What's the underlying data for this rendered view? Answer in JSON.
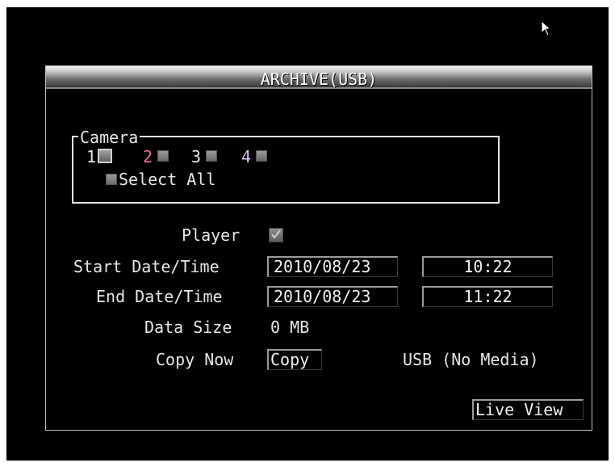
{
  "dialog": {
    "title": "ARCHIVE(USB)"
  },
  "camera_group": {
    "legend": "Camera",
    "cameras": [
      {
        "label": "1",
        "checked": false,
        "focused": true
      },
      {
        "label": "2",
        "checked": false,
        "focused": false
      },
      {
        "label": "3",
        "checked": false,
        "focused": false
      },
      {
        "label": "4",
        "checked": false,
        "focused": false
      }
    ],
    "select_all_label": "Select All"
  },
  "player": {
    "label": "Player",
    "checked": true
  },
  "start": {
    "label": "Start Date/Time",
    "date": "2010/08/23",
    "time": "10:22"
  },
  "end": {
    "label": "End Date/Time",
    "date": "2010/08/23",
    "time": "11:22"
  },
  "data_size": {
    "label": "Data Size",
    "value": "0 MB"
  },
  "copy_now": {
    "label": "Copy Now",
    "button": "Copy",
    "status": "USB (No Media)"
  },
  "live_view_button": "Live View",
  "icons": {
    "cursor": "mouse-pointer-icon",
    "check": "checkmark-icon"
  },
  "colors": {
    "background": "#000000",
    "text": "#e6e6e6",
    "camera_2": "#e86a9a",
    "camera_4": "#d9c3f0"
  }
}
